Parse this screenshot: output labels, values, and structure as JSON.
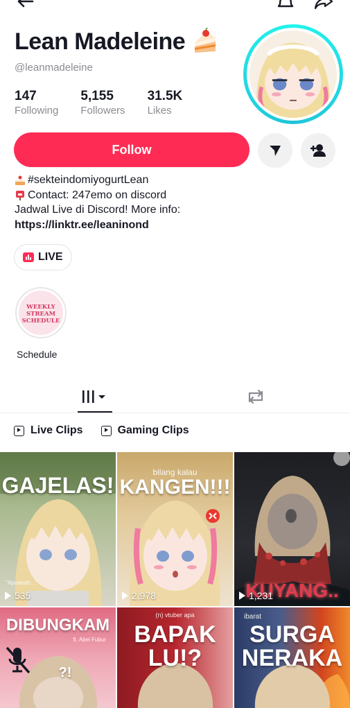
{
  "header": {
    "name": "Lean Madeleine",
    "name_emoji": "cake-emoji",
    "handle": "@leanmadeleine"
  },
  "stats": [
    {
      "value": "147",
      "label": "Following"
    },
    {
      "value": "5,155",
      "label": "Followers"
    },
    {
      "value": "31.5K",
      "label": "Likes"
    }
  ],
  "actions": {
    "follow_label": "Follow",
    "message_icon": "send-icon",
    "add_friend_icon": "add-user-icon"
  },
  "bio": {
    "line1": "#sekteindomiyogurtLean",
    "line2": "Contact: 247emo on discord",
    "line3": "Jadwal Live di Discord! More info:",
    "link": "https://linktr.ee/leaninond"
  },
  "live_label": "LIVE",
  "highlight": {
    "label": "Schedule",
    "cover_line1": "WEEKLY",
    "cover_line2": "STREAM",
    "cover_line3": "SCHEDULE"
  },
  "playlists": [
    {
      "label": "Live Clips"
    },
    {
      "label": "Gaming Clips"
    }
  ],
  "videos": [
    {
      "title": "GAJELAS!",
      "caption_top": "",
      "caption_bottom": "\"Apoansih...\"",
      "views": "535"
    },
    {
      "title": "KANGEN!!!",
      "caption_top": "bilang kalau",
      "views": "2,978"
    },
    {
      "title": "KUYANG..",
      "views": "1,231"
    },
    {
      "title": "DIBUNGKAM",
      "caption_sub": "ft. Abel Fubur",
      "extra": "?!"
    },
    {
      "title_line1": "BAPAK",
      "title_line2": "LU!?",
      "caption_top": "(n) vtuber apa"
    },
    {
      "title_line1": "SURGA",
      "title_line2": "NERAKA",
      "caption_top": "ibarat"
    }
  ],
  "colors": {
    "accent": "#fe2c55",
    "avatar_ring": "#25f4ee",
    "muted_text": "#8a8b91"
  }
}
